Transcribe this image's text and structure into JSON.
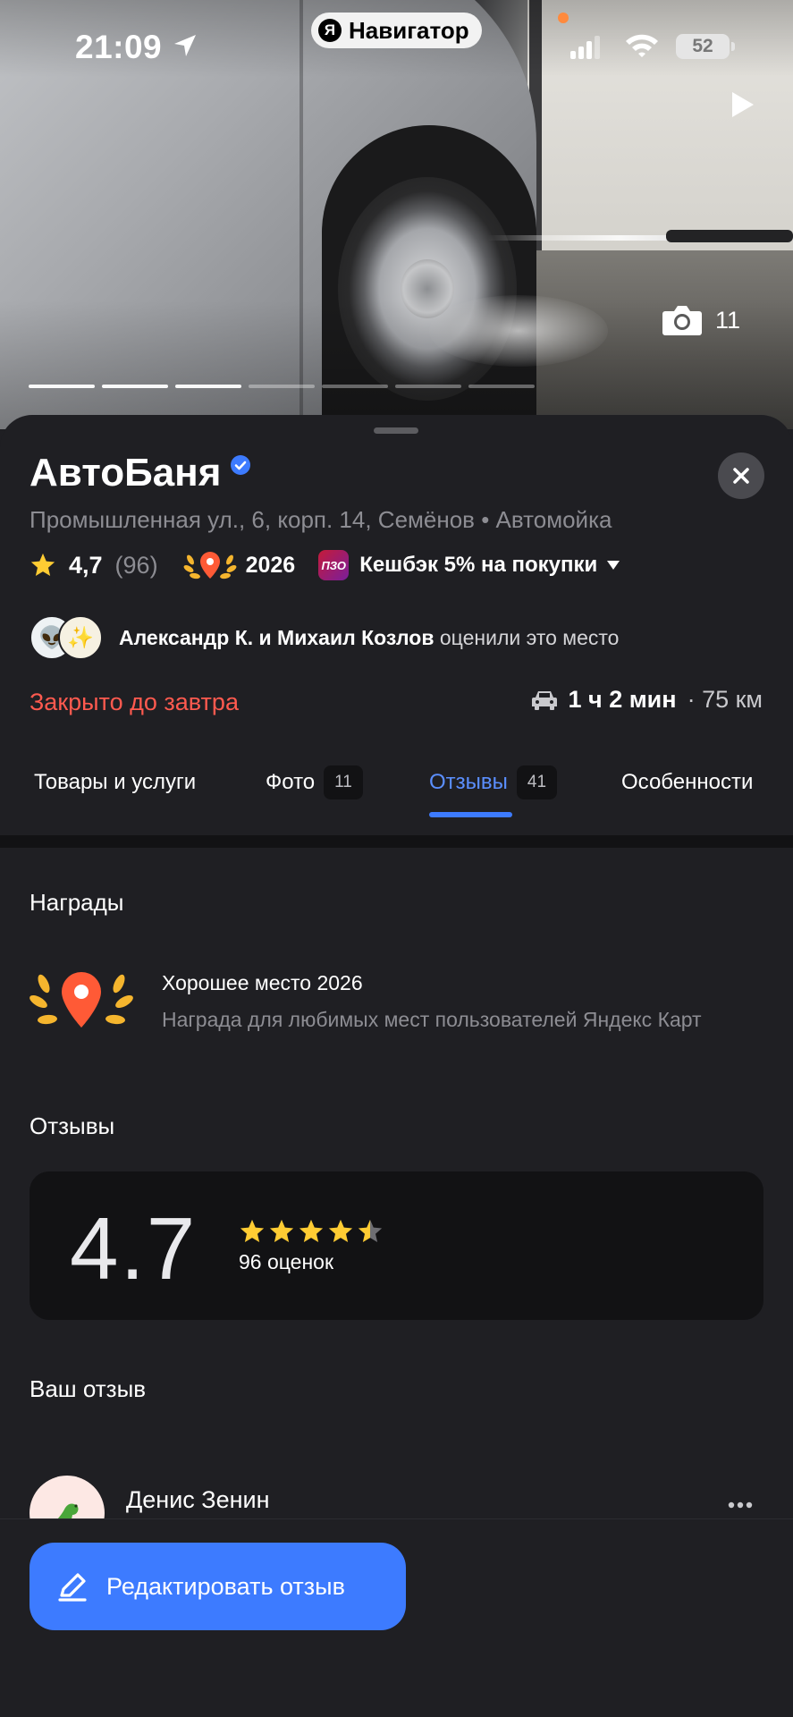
{
  "status_bar": {
    "time": "21:09",
    "battery": "52"
  },
  "top_pill": {
    "logo": "Я",
    "label": "Навигатор"
  },
  "gallery": {
    "photo_count": "11"
  },
  "place": {
    "name": "АвтоБаня",
    "address_line": "Промышленная ул., 6, корп. 14, Семёнов • Автомойка",
    "rating": "4,7",
    "rating_count": "(96)",
    "award_year": "2026",
    "cashback_logo": "ПЗО",
    "cashback": "Кешбэк 5% на покупки",
    "friends_names": "Александр К. и Михаил Козлов",
    "friends_suffix": " оценили это место",
    "status": "Закрыто до завтра",
    "route_time": "1 ч 2 мин",
    "route_distance": " · 75 км"
  },
  "tabs": [
    {
      "label": "Товары и услуги"
    },
    {
      "label": "Фото",
      "count": "11"
    },
    {
      "label": "Отзывы",
      "count": "41",
      "active": true
    },
    {
      "label": "Особенности"
    }
  ],
  "awards_section": {
    "heading": "Награды",
    "title": "Хорошее место 2026",
    "description": "Награда для любимых мест пользователей Яндекс Карт"
  },
  "reviews_section": {
    "heading": "Отзывы",
    "rating": "4.7",
    "stars_filled": 4.5,
    "votes": "96 оценок"
  },
  "your_review": {
    "heading": "Ваш отзыв",
    "user_name": "Денис Зенин"
  },
  "edit_button": {
    "label": "Редактировать отзыв"
  },
  "colors": {
    "accent": "#3d7bff",
    "closed": "#ff5a4f",
    "star": "#ffcc33",
    "background": "#1f1f23"
  },
  "icons": [
    "location-arrow-icon",
    "signal-icon",
    "wifi-icon",
    "play-icon",
    "camera-icon",
    "verified-icon",
    "close-icon",
    "star-icon",
    "award-laurel-icon",
    "caret-down-icon",
    "car-icon",
    "more-icon",
    "pencil-icon"
  ]
}
